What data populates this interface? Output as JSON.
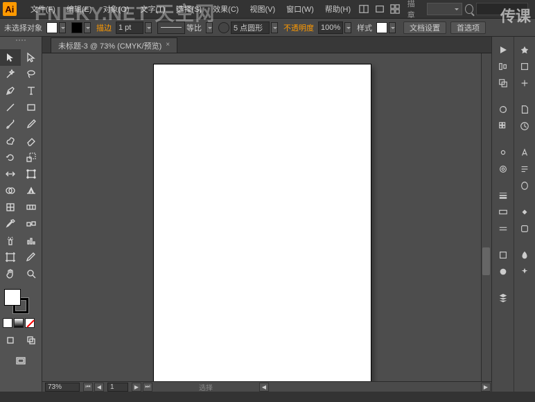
{
  "app": {
    "logo": "Ai"
  },
  "menu": {
    "file": "文件(F)",
    "edit": "编辑(E)",
    "object": "对象(O)",
    "type": "文字(T)",
    "select": "选择(S)",
    "effect": "效果(C)",
    "view": "视图(V)",
    "window": "窗口(W)",
    "help": "帮助(H)",
    "essentials_label": "描章",
    "search_placeholder": ""
  },
  "options": {
    "no_selection": "未选择对象",
    "fill_color": "#ffffff",
    "stroke_color": "#000000",
    "stroke_label": "描边",
    "stroke_weight": "1 pt",
    "stroke_profile_label": "等比",
    "brush": "5 点圆形",
    "opacity_label": "不透明度",
    "opacity_value": "100%",
    "style_label": "样式",
    "doc_setup": "文档设置",
    "preferences": "首选项"
  },
  "document": {
    "tab_title": "未标题-3 @ 73% (CMYK/预览)",
    "zoom": "73%"
  },
  "status": {
    "center": "选择"
  },
  "watermark": {
    "site": "FNEKY.NET 天空网",
    "brand": "传课"
  },
  "colors": {
    "fill": "#ffffff",
    "stroke": "#000000",
    "none": "none",
    "accent": "#ff9a00"
  }
}
